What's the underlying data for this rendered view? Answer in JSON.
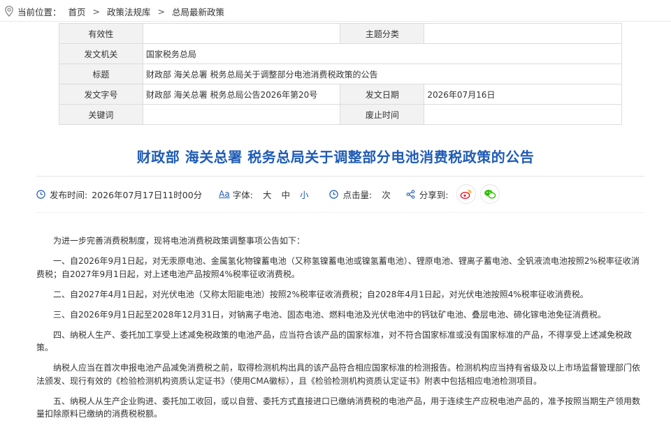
{
  "breadcrumb": {
    "prefix": "当前位置：",
    "items": [
      "首页",
      "政策法规库",
      "总局最新政策"
    ],
    "separator": ">"
  },
  "meta": {
    "rows": [
      {
        "label1": "有效性",
        "value1": "",
        "label2": "主题分类",
        "value2": ""
      },
      {
        "label1": "发文机关",
        "value1": "国家税务总局"
      },
      {
        "label1": "标题",
        "value1": "财政部 海关总署 税务总局关于调整部分电池消费税政策的公告"
      },
      {
        "label1": "发文字号",
        "value1": "财政部 海关总署 税务总局公告2026年第20号",
        "label2": "发文日期",
        "value2": "2026年07月16日"
      },
      {
        "label1": "关键词",
        "value1": "",
        "label2": "废止时间",
        "value2": ""
      }
    ]
  },
  "title": "财政部 海关总署 税务总局关于调整部分电池消费税政策的公告",
  "info": {
    "publish_label": "发布时间:",
    "publish_time": "2026年07月17日11时00分",
    "font_icon_text": "Aa",
    "font_label": "字体:",
    "font_large": "大",
    "font_medium": "中",
    "font_small": "小",
    "clicks_label": "点击量:",
    "clicks_suffix": "次",
    "share_label": "分享到:",
    "colors": {
      "accent": "#1f5bb5",
      "weibo": "#e6162d",
      "wechat": "#2dc100",
      "icon": "#1f5bb5"
    }
  },
  "paragraphs": [
    "为进一步完善消费税制度，现将电池消费税政策调整事项公告如下：",
    "一、自2026年9月1日起，对无汞原电池、金属氢化物镍蓄电池（又称氢镍蓄电池或镍氢蓄电池）、锂原电池、锂离子蓄电池、全钒液流电池按照2%税率征收消费税；自2027年9月1日起，对上述电池产品按照4%税率征收消费税。",
    "二、自2027年4月1日起，对光伏电池（又称太阳能电池）按照2%税率征收消费税；自2028年4月1日起，对光伏电池按照4%税率征收消费税。",
    "三、自2026年9月1日起至2028年12月31日，对钠离子电池、固态电池、燃料电池及光伏电池中的钙钛矿电池、叠层电池、碲化镓电池免征消费税。",
    "四、纳税人生产、委托加工享受上述减免税政策的电池产品，应当符合该产品的国家标准，对不符合国家标准或没有国家标准的产品，不得享受上述减免税政策。",
    "纳税人应当在首次申报电池产品减免消费税之前，取得检测机构出具的该产品符合相应国家标准的检测报告。检测机构应当持有省级及以上市场监督管理部门依法颁发、现行有效的《检验检测机构资质认定证书》（使用CMA徽标），且《检验检测机构资质认定证书》附表中包括相应电池检测项目。",
    "五、纳税人从生产企业购进、委托加工收回，或以自营、委托方式直接进口已缴纳消费税的电池产品，用于连续生产应税电池产品的，准予按照当期生产领用数量扣除原料已缴纳的消费税税额。"
  ]
}
